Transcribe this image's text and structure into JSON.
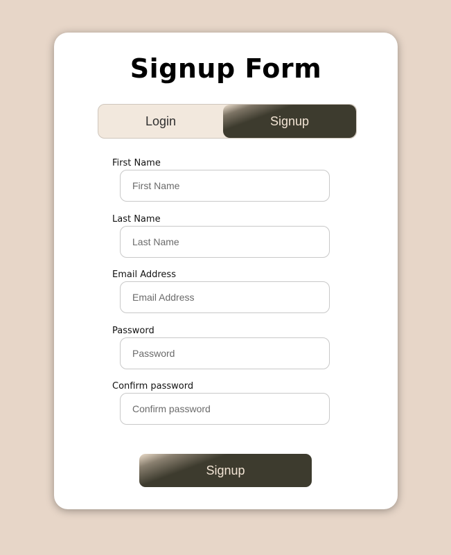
{
  "form": {
    "title": "Signup Form",
    "tabs": {
      "login_label": "Login",
      "signup_label": "Signup"
    },
    "fields": [
      {
        "label": "First Name",
        "placeholder": "First Name",
        "value": ""
      },
      {
        "label": "Last Name",
        "placeholder": "Last Name",
        "value": ""
      },
      {
        "label": "Email Address",
        "placeholder": "Email Address",
        "value": ""
      },
      {
        "label": "Password",
        "placeholder": "Password",
        "value": ""
      },
      {
        "label": "Confirm password",
        "placeholder": "Confirm password",
        "value": ""
      }
    ],
    "submit_label": "Signup"
  },
  "colors": {
    "background": "#e7d6c8",
    "card": "#ffffff",
    "accent_dark": "#3d3b2e",
    "accent_light": "#f2e8dd",
    "button_text": "#f2e4d4"
  }
}
